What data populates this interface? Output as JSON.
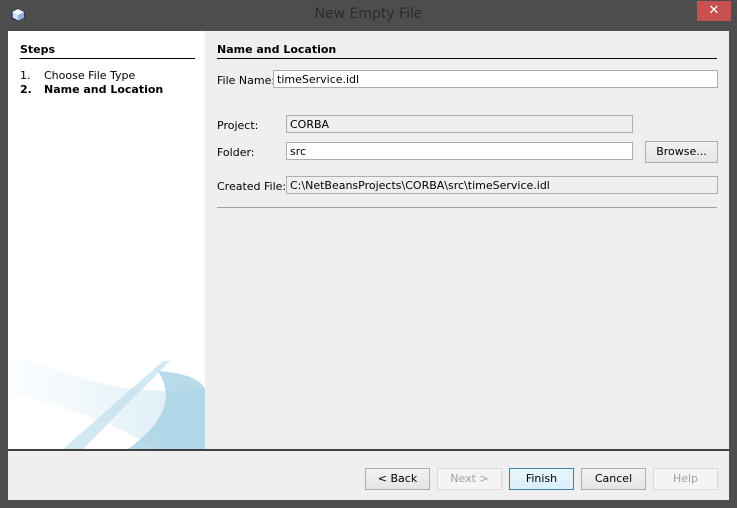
{
  "window": {
    "title": "New Empty File",
    "close_label": "✕",
    "colors": {
      "close": "#c75050",
      "frame": "#4d4d4d"
    }
  },
  "steps": {
    "heading": "Steps",
    "items": [
      {
        "num": "1.",
        "label": "Choose File Type",
        "active": false
      },
      {
        "num": "2.",
        "label": "Name and Location",
        "active": true
      }
    ]
  },
  "form": {
    "heading": "Name and Location",
    "file_name": {
      "label": "File Name:",
      "value": "timeService.idl"
    },
    "project": {
      "label": "Project:",
      "value": "CORBA"
    },
    "folder": {
      "label": "Folder:",
      "value": "src",
      "browse_label": "Browse..."
    },
    "created_file": {
      "label": "Created File:",
      "value": "C:\\NetBeansProjects\\CORBA\\src\\timeService.idl"
    }
  },
  "buttons": {
    "back": "< Back",
    "next": "Next >",
    "finish": "Finish",
    "cancel": "Cancel",
    "help": "Help"
  }
}
